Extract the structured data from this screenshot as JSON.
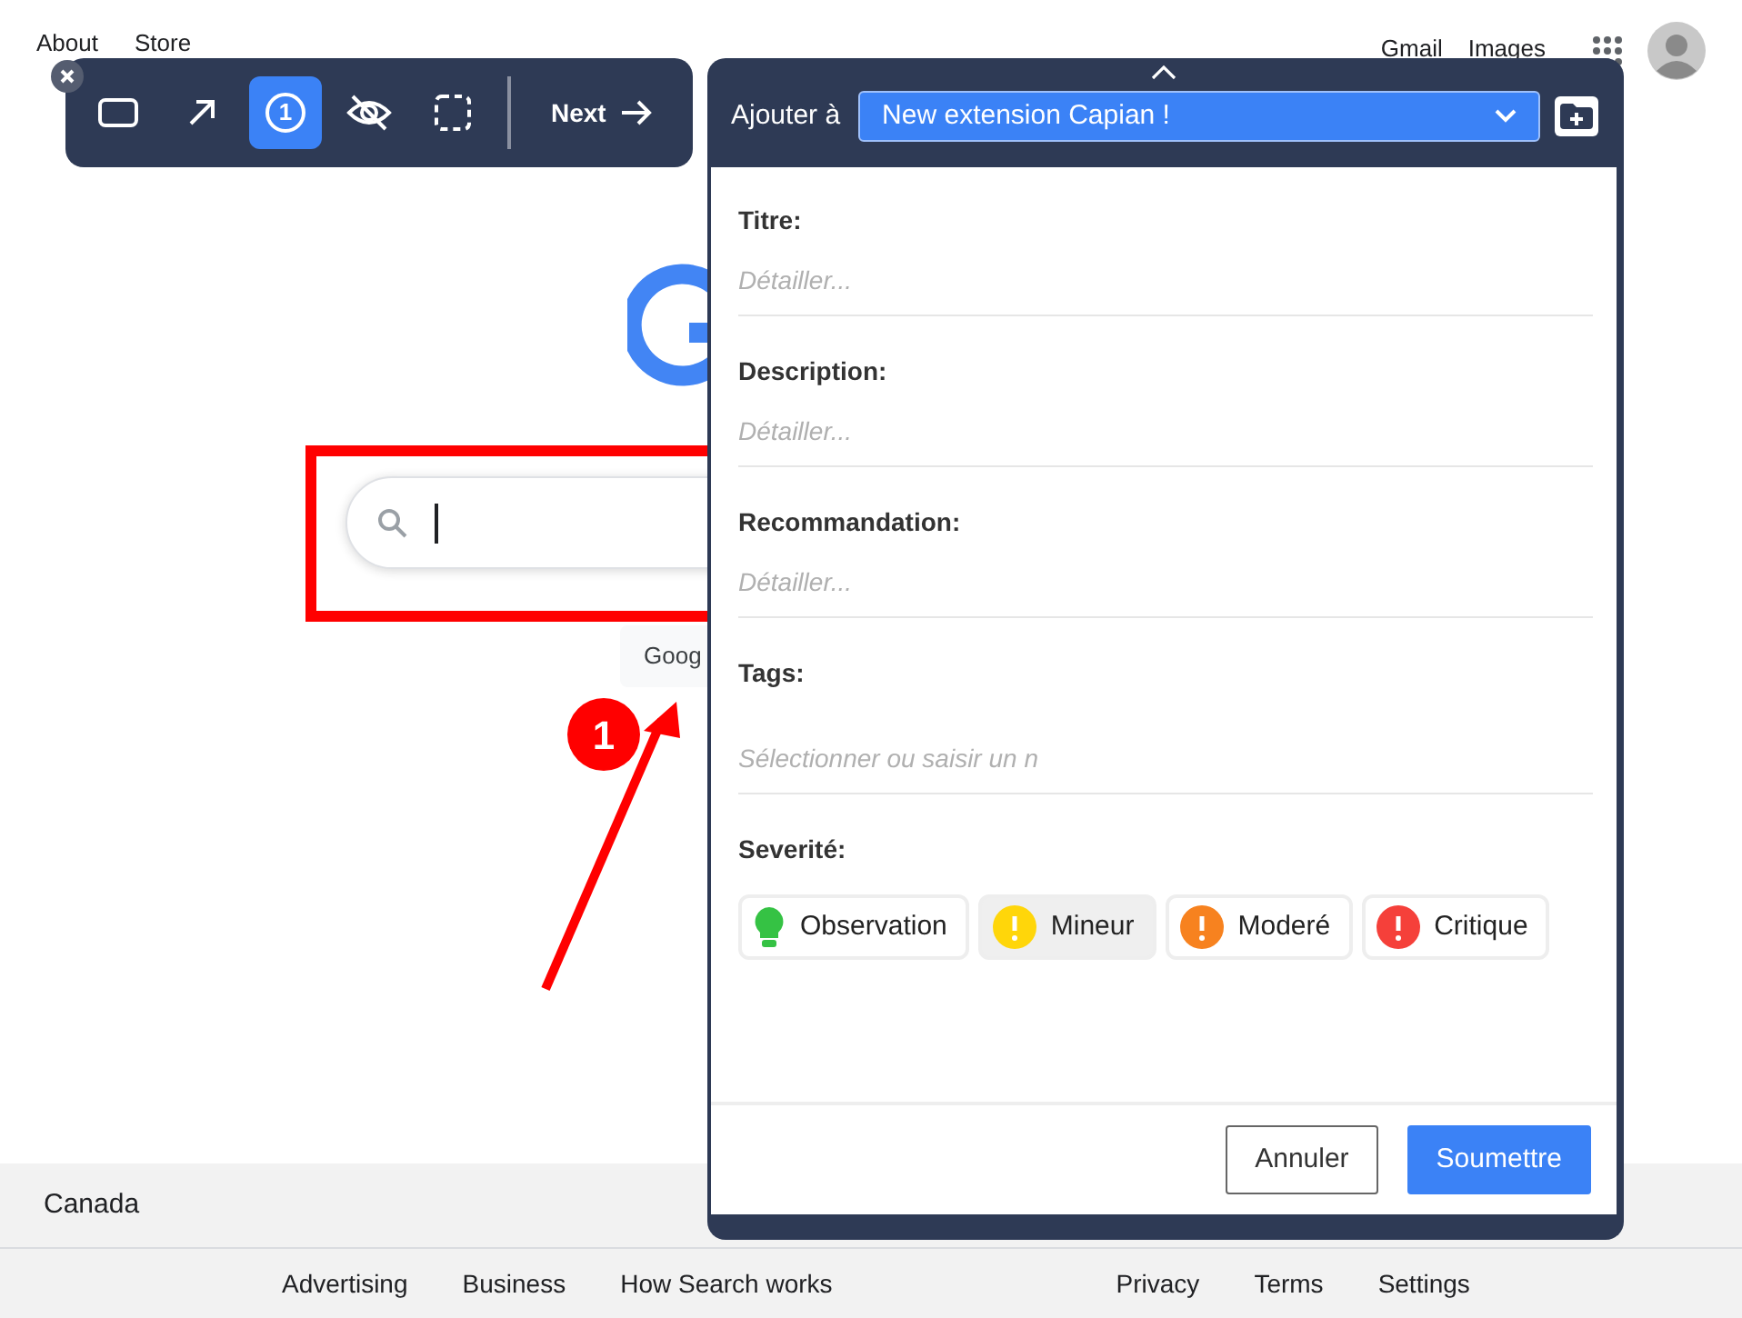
{
  "google_header": {
    "left_links": [
      "About",
      "Store"
    ],
    "right_links": [
      "Gmail",
      "Images"
    ]
  },
  "search_button": "Goog",
  "annotation": {
    "badge": "1"
  },
  "toolbar": {
    "tools": [
      {
        "kind": "rectangle",
        "selected": false
      },
      {
        "kind": "arrow",
        "selected": false
      },
      {
        "kind": "number",
        "label": "1",
        "selected": true
      },
      {
        "kind": "hide",
        "selected": false
      },
      {
        "kind": "select",
        "selected": false
      }
    ],
    "next": "Next"
  },
  "panel": {
    "label": "Ajouter à",
    "project": "New extension Capian !",
    "fields": [
      {
        "label": "Titre:",
        "placeholder": "Détailler..."
      },
      {
        "label": "Description:",
        "placeholder": "Détailler..."
      },
      {
        "label": "Recommandation:",
        "placeholder": "Détailler..."
      },
      {
        "label": "Tags:",
        "placeholder": "Sélectionner ou saisir un n"
      }
    ],
    "severity": {
      "label": "Severité:",
      "options": [
        {
          "label": "Observation",
          "kind": "bulb",
          "color": "#35c244",
          "selected": false
        },
        {
          "label": "Mineur",
          "kind": "alert",
          "color": "#ffd60a",
          "selected": true
        },
        {
          "label": "Moderé",
          "kind": "alert",
          "color": "#f7821f",
          "selected": false
        },
        {
          "label": "Critique",
          "kind": "alert",
          "color": "#f5403a",
          "selected": false
        }
      ]
    },
    "buttons": [
      {
        "label": "Annuler",
        "kind": "secondary"
      },
      {
        "label": "Soumettre",
        "kind": "primary"
      }
    ]
  },
  "footer": {
    "country": "Canada",
    "links_left": [
      "Advertising",
      "Business",
      "How Search works"
    ],
    "links_right": [
      "Privacy",
      "Terms",
      "Settings"
    ]
  }
}
